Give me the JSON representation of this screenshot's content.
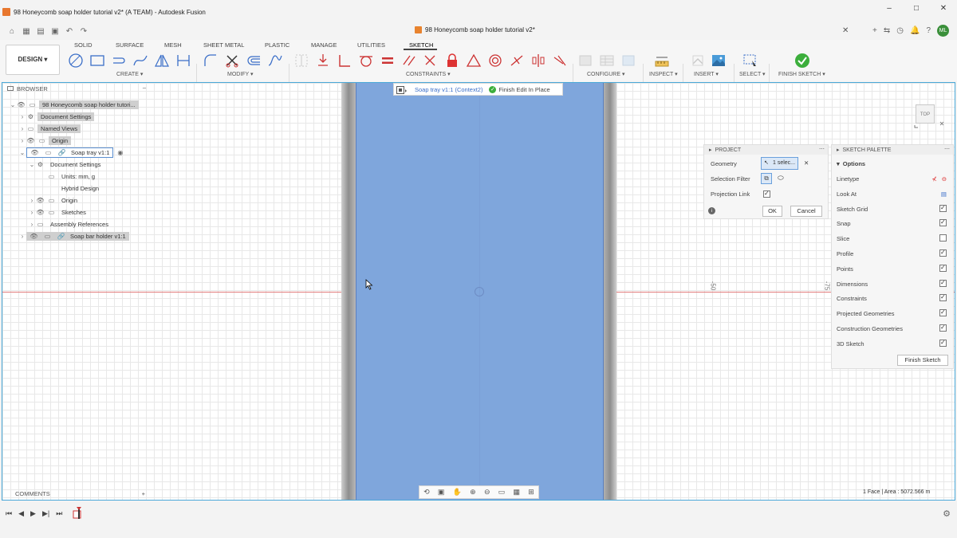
{
  "window": {
    "title": "98 Honeycomb soap holder tutorial v2* (A TEAM) - Autodesk Fusion",
    "controls": [
      "–",
      "□",
      "✕"
    ]
  },
  "document_tab": {
    "label": "98 Honeycomb soap holder tutorial v2*",
    "close": "✕",
    "avatar": "ML"
  },
  "workspace": {
    "label": "DESIGN ▾"
  },
  "toolbar_tabs": [
    "SOLID",
    "SURFACE",
    "MESH",
    "SHEET METAL",
    "PLASTIC",
    "MANAGE",
    "UTILITIES",
    "SKETCH"
  ],
  "toolbar_groups": {
    "create": "CREATE ▾",
    "modify": "MODIFY ▾",
    "constraints": "CONSTRAINTS ▾",
    "configure": "CONFIGURE ▾",
    "inspect": "INSPECT ▾",
    "insert": "INSERT ▾",
    "select": "SELECT ▾",
    "finish": "FINISH SKETCH ▾"
  },
  "context_bar": {
    "component": "Soap tray v1:1 (Context2)",
    "finish": "Finish Edit In Place"
  },
  "browser": {
    "title": "BROWSER",
    "root": "98 Honeycomb soap holder tutori...",
    "document_settings": "Document Settings",
    "named_views": "Named Views",
    "origin": "Origin",
    "soap_tray": "Soap tray v1:1",
    "sub_document_settings": "Document Settings",
    "units": "Units: mm, g",
    "hybrid_design": "Hybrid Design",
    "sub_origin": "Origin",
    "sketches": "Sketches",
    "assembly_references": "Assembly References",
    "soap_bar_holder": "Soap bar holder v1:1"
  },
  "project": {
    "title": "PROJECT",
    "geometry_label": "Geometry",
    "geometry_value": "1 selec...",
    "selection_filter_label": "Selection Filter",
    "projection_link_label": "Projection Link",
    "projection_link": true,
    "ok": "OK",
    "cancel": "Cancel"
  },
  "palette": {
    "title": "SKETCH PALETTE",
    "options": "Options",
    "linetype": "Linetype",
    "look_at": "Look At",
    "finish_sketch": "Finish Sketch",
    "toggles": [
      {
        "label": "Sketch Grid",
        "on": true
      },
      {
        "label": "Snap",
        "on": true
      },
      {
        "label": "Slice",
        "on": false
      },
      {
        "label": "Profile",
        "on": true
      },
      {
        "label": "Points",
        "on": true
      },
      {
        "label": "Dimensions",
        "on": true
      },
      {
        "label": "Constraints",
        "on": true
      },
      {
        "label": "Projected Geometries",
        "on": true
      },
      {
        "label": "Construction Geometries",
        "on": true
      },
      {
        "label": "3D Sketch",
        "on": true
      }
    ]
  },
  "viewcube": {
    "label": "TOP"
  },
  "rulers": {
    "r50": "-50",
    "r75": "-75"
  },
  "comments": {
    "label": "COMMENTS",
    "add": "+"
  },
  "status": {
    "text": "1 Face | Area : 5072.566 m"
  },
  "colors": {
    "accent": "#3a6ec8",
    "face": "#7fa6dc",
    "finish_green": "#3cae3c"
  }
}
